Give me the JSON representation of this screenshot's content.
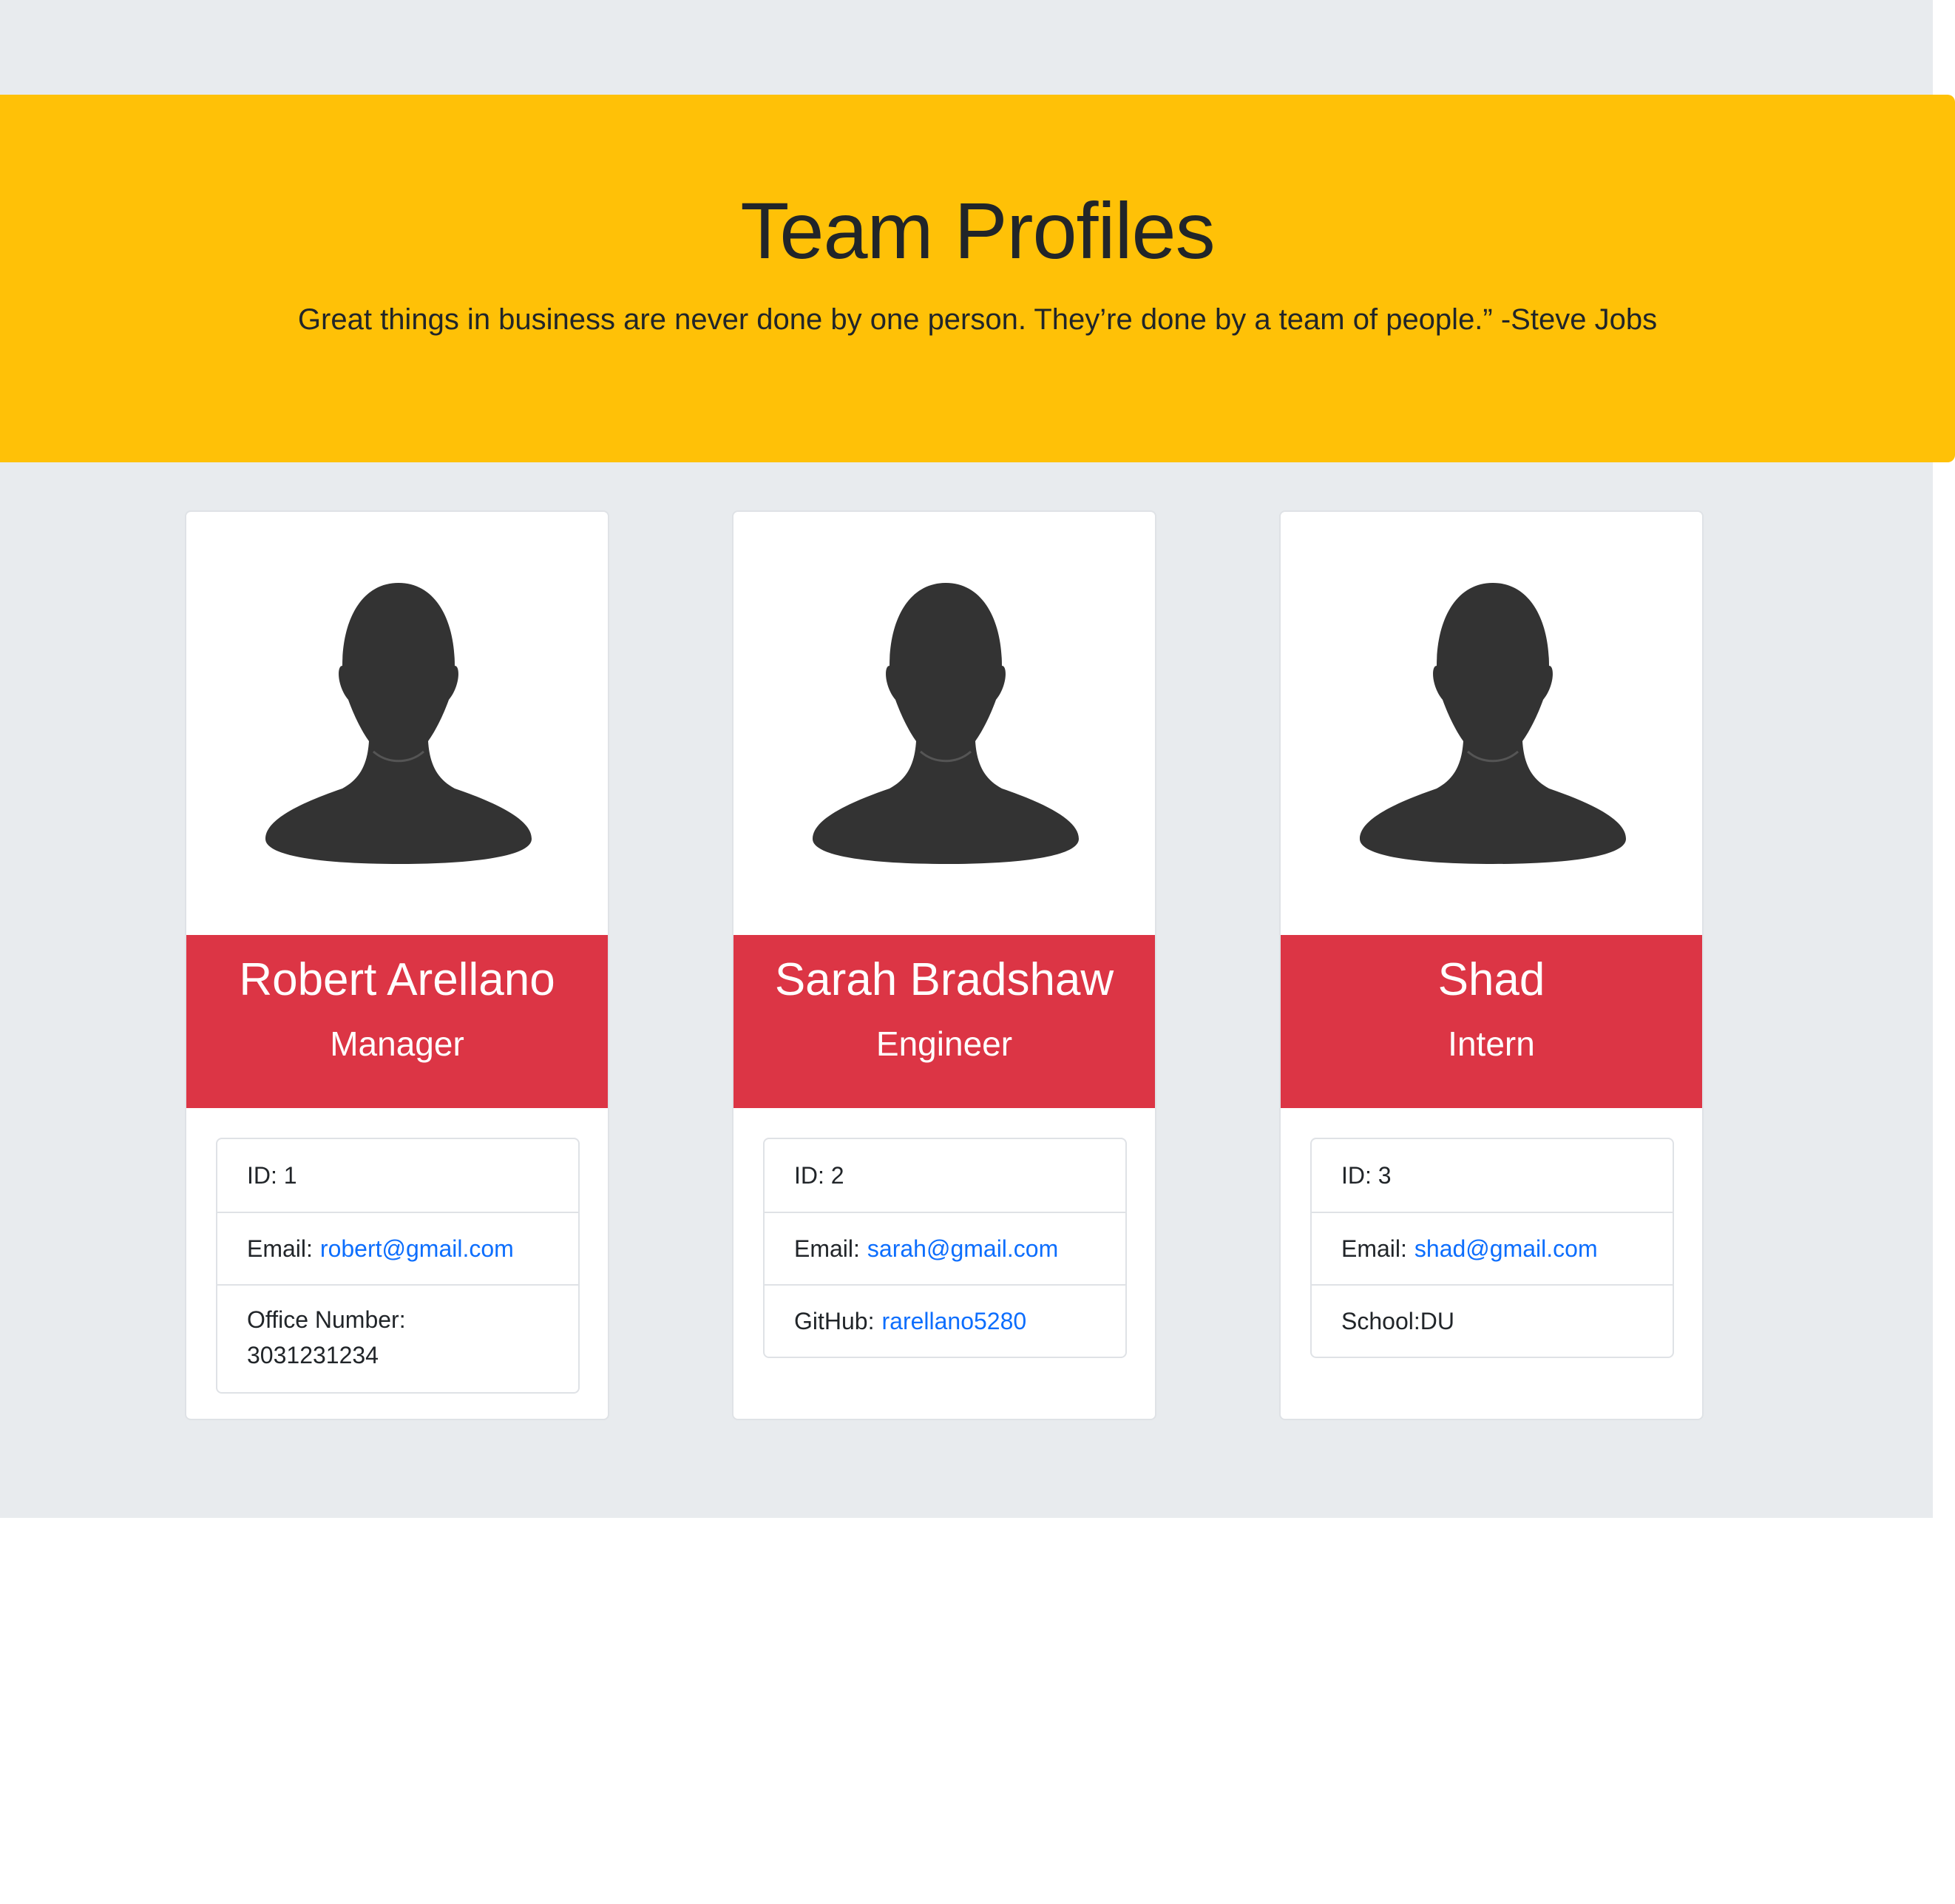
{
  "header": {
    "title": "Team Profiles",
    "quote": "Great things in business are never done by one person. They’re done by a team of people.” -Steve Jobs"
  },
  "colors": {
    "page_bg": "#e8ebee",
    "jumbotron": "#ffc107",
    "card_header": "#dc3545",
    "link": "#0d6efd"
  },
  "cards": [
    {
      "name": "Robert Arellano",
      "role": "Manager",
      "id_text": "ID: 1",
      "email_label": "Email:",
      "email": "robert@gmail.com",
      "extra_label": "Office Number:",
      "extra_value": "3031231234",
      "avatar_icon": "person-silhouette-icon"
    },
    {
      "name": "Sarah Bradshaw",
      "role": "Engineer",
      "id_text": "ID: 2",
      "email_label": "Email:",
      "email": "sarah@gmail.com",
      "extra_label": "GitHub:",
      "extra_value": "rarellano5280",
      "avatar_icon": "person-silhouette-icon"
    },
    {
      "name": "Shad",
      "role": "Intern",
      "id_text": "ID: 3",
      "email_label": "Email:",
      "email": "shad@gmail.com",
      "extra_label": "School:",
      "extra_value": "DU",
      "avatar_icon": "person-silhouette-icon"
    }
  ]
}
